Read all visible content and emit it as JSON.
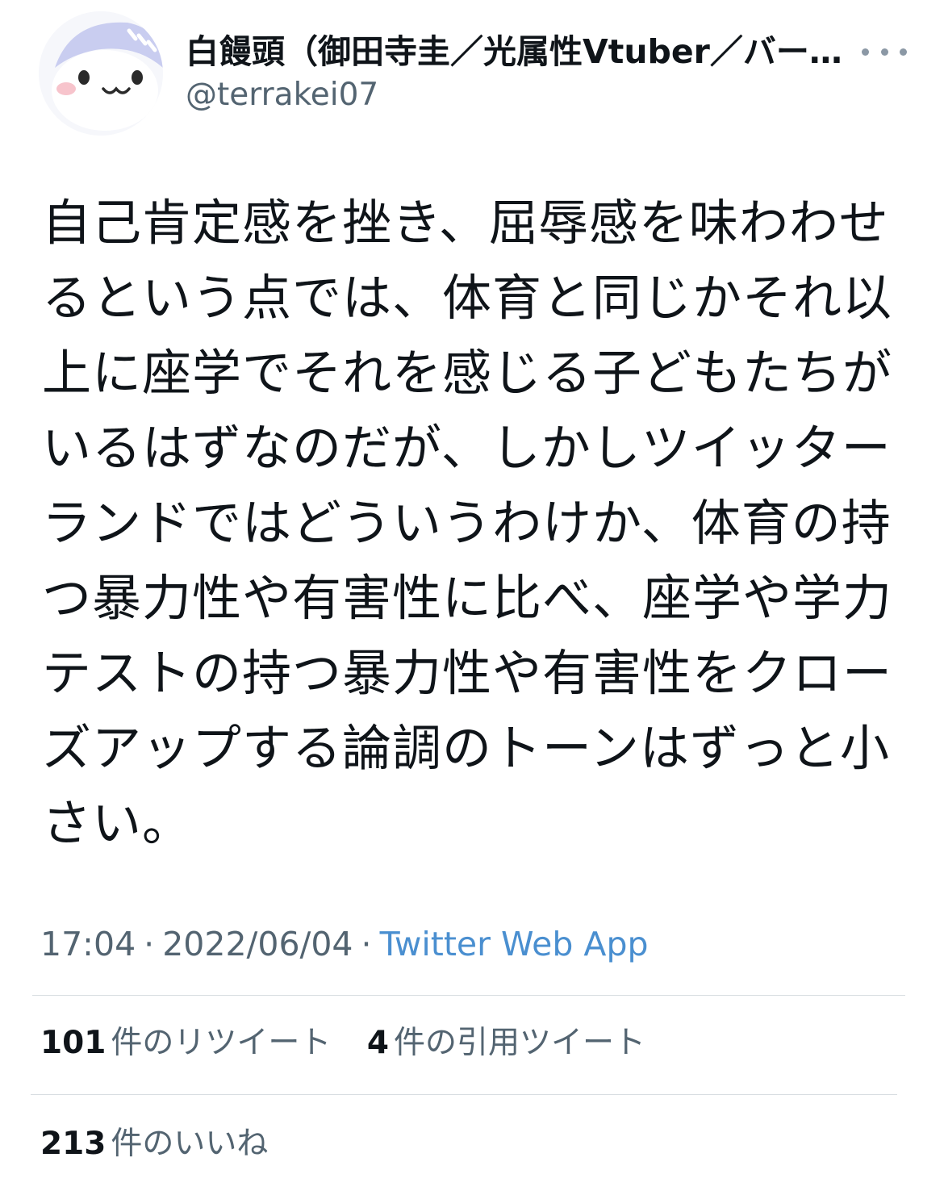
{
  "user": {
    "display_name": "白饅頭（御田寺圭／光属性Vtuber／バー…",
    "handle": "@terrakei07",
    "avatar_icon": "avatar-icon"
  },
  "tweet": {
    "lines": [
      "自己肯定感を挫き、屈辱感を味わわせ",
      "るという点では、体育と同じかそれ以",
      "上に座学でそれを感じる子どもたちが",
      "いるはずなのだが、しかしツイッター",
      "ランドではどういうわけか、体育の持",
      "つ暴力性や有害性に比べ、座学や学力",
      "テストの持つ暴力性や有害性をクロー",
      "ズアップする論調のトーンはずっと小",
      "さい。"
    ]
  },
  "meta": {
    "time": "17:04",
    "separator": "·",
    "date": "2022/06/04",
    "source": "Twitter Web App"
  },
  "stats": {
    "retweets_count": "101",
    "retweets_label": "件のリツイート",
    "quotes_count": "4",
    "quotes_label": "件の引用ツイート",
    "likes_count": "213",
    "likes_label": "件のいいね"
  },
  "colors": {
    "text": "#0f1419",
    "secondary": "#536471",
    "link": "#4a8fd0",
    "divider": "#d8dde1"
  }
}
